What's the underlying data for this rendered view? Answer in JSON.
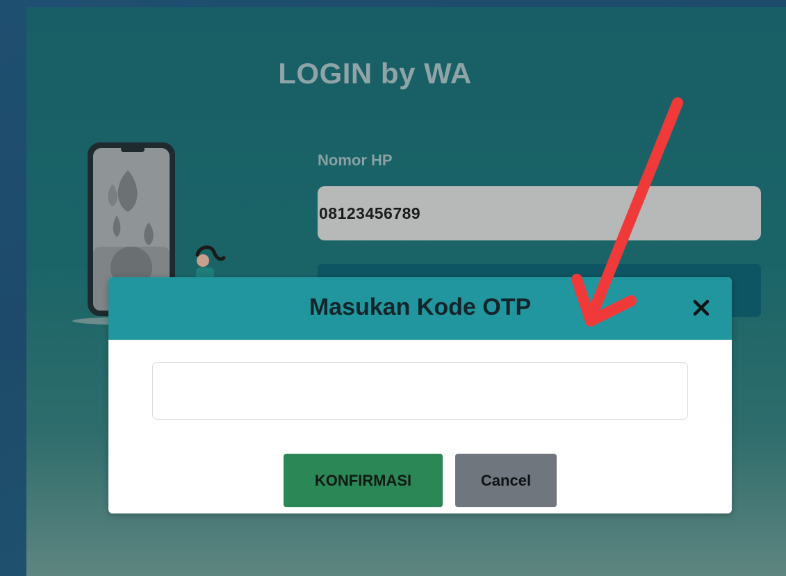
{
  "login": {
    "title": "LOGIN by WA",
    "phone_label": "Nomor HP",
    "phone_value": "08123456789"
  },
  "modal": {
    "title": "Masukan Kode OTP",
    "otp_value": "",
    "confirm_label": "KONFIRMASI",
    "cancel_label": "Cancel"
  },
  "colors": {
    "modal_header": "#21969f",
    "confirm_button": "#2b8755",
    "cancel_button": "#6f767d",
    "annotation_arrow": "#f03a3a"
  },
  "icons": {
    "close": "close-icon",
    "illustration": "phone-illustration-icon",
    "annotation": "red-arrow-annotation"
  }
}
